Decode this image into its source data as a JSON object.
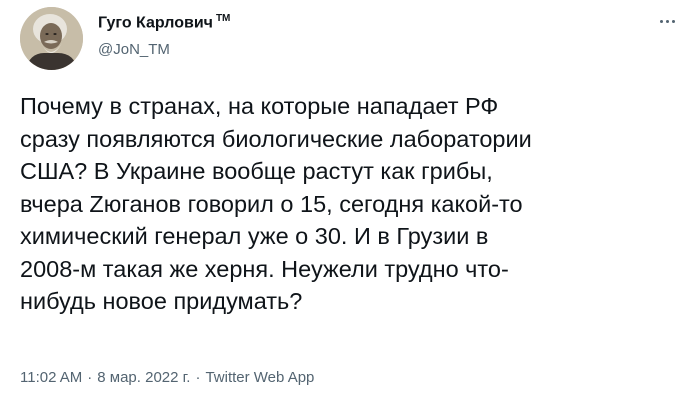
{
  "author": {
    "display_name": "Гуго Карлович",
    "badge": "TM",
    "handle": "@JoN_TM",
    "avatar_icon": "portrait-avatar"
  },
  "menu": {
    "icon": "more-horizontal-icon"
  },
  "tweet": {
    "text": "Почему в странах, на которые нападает РФ\nсразу появляются биологические лаборатории\nСША? В Украине вообще растут как грибы,\nвчера Zюганов говорил о 15, сегодня какой-то\nхимический генерал уже о 30. И в Грузии в\n2008-м такая же херня. Неужели трудно что-\nнибудь новое придумать?"
  },
  "meta": {
    "time": "11:02 AM",
    "separator": "·",
    "date": "8 мар. 2022 г.",
    "source": "Twitter Web App"
  },
  "colors": {
    "text": "#0f1419",
    "secondary": "#536471",
    "background": "#ffffff"
  }
}
